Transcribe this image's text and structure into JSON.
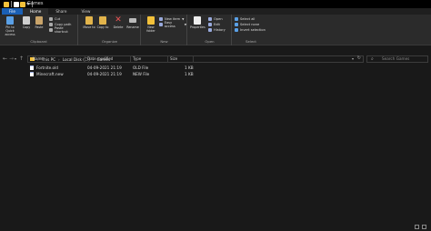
{
  "window": {
    "title": "Games"
  },
  "tabs": [
    {
      "label": "File"
    },
    {
      "label": "Home"
    },
    {
      "label": "Share"
    },
    {
      "label": "View"
    }
  ],
  "ribbon": {
    "clipboard": {
      "pin_label": "Pin to Quick access",
      "copy_label": "Copy",
      "paste_label": "Paste",
      "cut_label": "Cut",
      "copy_path_label": "Copy path",
      "paste_shortcut_label": "Paste shortcut",
      "group_label": "Clipboard"
    },
    "organize": {
      "move_to_label": "Move to",
      "copy_to_label": "Copy to",
      "delete_label": "Delete",
      "rename_label": "Rename",
      "group_label": "Organize"
    },
    "new": {
      "new_folder_label": "New folder",
      "new_item_label": "New item",
      "easy_access_label": "Easy access",
      "group_label": "New"
    },
    "open": {
      "properties_label": "Properties",
      "open_label": "Open",
      "edit_label": "Edit",
      "history_label": "History",
      "group_label": "Open"
    },
    "select": {
      "select_all_label": "Select all",
      "select_none_label": "Select none",
      "invert_label": "Invert selection",
      "group_label": "Select"
    }
  },
  "address": {
    "crumbs": [
      "This PC",
      "Local Disk (C:)",
      "Games"
    ]
  },
  "search": {
    "placeholder": "Search Games"
  },
  "columns": {
    "name": "Name",
    "date": "Date modified",
    "type": "Type",
    "size": "Size"
  },
  "files": [
    {
      "name": "Fortnite.old",
      "date": "04-09-2021 21:19",
      "type": "OLD File",
      "size": "1 KB"
    },
    {
      "name": "Minecraft.new",
      "date": "04-09-2021 21:19",
      "type": "NEW File",
      "size": "1 KB"
    }
  ],
  "icons": {
    "folder": "folder-icon",
    "file": "file-icon",
    "nav_back": "back-arrow-icon",
    "nav_forward": "forward-arrow-icon",
    "nav_up": "up-arrow-icon",
    "search": "search-icon"
  },
  "colors": {
    "file_tab": "#1a5fb4",
    "background": "#191919",
    "ribbon": "#2b2b2b",
    "folder": "#f3c13a"
  }
}
